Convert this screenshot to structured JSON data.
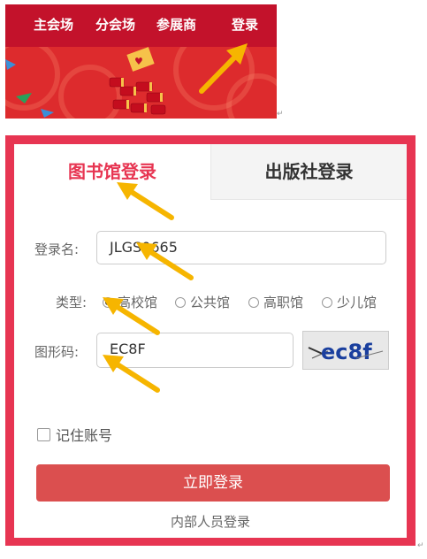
{
  "nav": {
    "items": [
      "主会场",
      "分会场",
      "参展商",
      "登录"
    ]
  },
  "tabs": {
    "library_label": "图书馆登录",
    "publisher_label": "出版社登录"
  },
  "form": {
    "username_label": "登录名:",
    "username_value": "JLGS0665",
    "type_label": "类型:",
    "type_options": [
      "高校馆",
      "公共馆",
      "高职馆",
      "少儿馆"
    ],
    "type_selected": "高校馆",
    "captcha_label": "图形码:",
    "captcha_value": "EC8F",
    "captcha_image_text": "ec8f",
    "remember_label": "记住账号",
    "remember_checked": false,
    "submit_label": "立即登录",
    "internal_link": "内部人员登录"
  },
  "colors": {
    "nav_bg": "#c3122b",
    "panel_border": "#e73552",
    "button_bg": "#db4f4f",
    "arrow": "#f6b500"
  },
  "icons": [
    "firecracker-icon",
    "arrow-pointer-icon",
    "radio-icon",
    "checkbox-icon"
  ]
}
